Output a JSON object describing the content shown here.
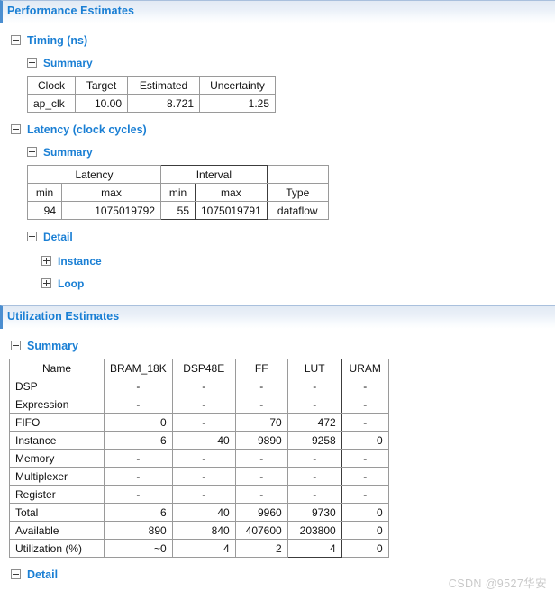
{
  "sections": [
    {
      "id": "performance",
      "title": "Performance Estimates"
    },
    {
      "id": "utilization",
      "title": "Utilization Estimates"
    }
  ],
  "tree": {
    "timing": "Timing (ns)",
    "timing_summary": "Summary",
    "latency": "Latency (clock cycles)",
    "latency_summary": "Summary",
    "latency_detail": "Detail",
    "latency_detail_instance": "Instance",
    "latency_detail_loop": "Loop",
    "util_summary": "Summary",
    "util_detail": "Detail"
  },
  "icons": {
    "minus": "minus-square-icon",
    "plus": "plus-square-icon"
  },
  "timing_table": {
    "headers": [
      "Clock",
      "Target",
      "Estimated",
      "Uncertainty"
    ],
    "rows": [
      [
        "ap_clk",
        "10.00",
        "8.721",
        "1.25"
      ]
    ]
  },
  "latency_table": {
    "group_headers": [
      "Latency",
      "Interval",
      ""
    ],
    "headers": [
      "min",
      "max",
      "min",
      "max",
      "Type"
    ],
    "rows": [
      [
        "94",
        "1075019792",
        "55",
        "1075019791",
        "dataflow"
      ]
    ]
  },
  "utilization_table": {
    "headers": [
      "Name",
      "BRAM_18K",
      "DSP48E",
      "FF",
      "LUT",
      "URAM"
    ],
    "rows": [
      {
        "name": "DSP",
        "values": [
          "-",
          "-",
          "-",
          "-",
          "-"
        ],
        "shaded": false
      },
      {
        "name": "Expression",
        "values": [
          "-",
          "-",
          "-",
          "-",
          "-"
        ],
        "shaded": false
      },
      {
        "name": "FIFO",
        "values": [
          "0",
          "-",
          "70",
          "472",
          "-"
        ],
        "shaded": false
      },
      {
        "name": "Instance",
        "values": [
          "6",
          "40",
          "9890",
          "9258",
          "0"
        ],
        "shaded": false
      },
      {
        "name": "Memory",
        "values": [
          "-",
          "-",
          "-",
          "-",
          "-"
        ],
        "shaded": false
      },
      {
        "name": "Multiplexer",
        "values": [
          "-",
          "-",
          "-",
          "-",
          "-"
        ],
        "shaded": false
      },
      {
        "name": "Register",
        "values": [
          "-",
          "-",
          "-",
          "-",
          "-"
        ],
        "shaded": false
      },
      {
        "name": "Total",
        "values": [
          "6",
          "40",
          "9960",
          "9730",
          "0"
        ],
        "shaded": true
      },
      {
        "name": "Available",
        "values": [
          "890",
          "840",
          "407600",
          "203800",
          "0"
        ],
        "shaded": false
      },
      {
        "name": "Utilization (%)",
        "values": [
          "~0",
          "4",
          "2",
          "4",
          "0"
        ],
        "shaded": true
      }
    ]
  },
  "watermark": "CSDN @9527华安",
  "colors": {
    "accent": "#1a7fd4",
    "banner_border": "#4b8ed0",
    "grid_line": "#9a9a9a",
    "shaded_row": "#c4c4c4",
    "watermark": "#c9c9c9"
  }
}
